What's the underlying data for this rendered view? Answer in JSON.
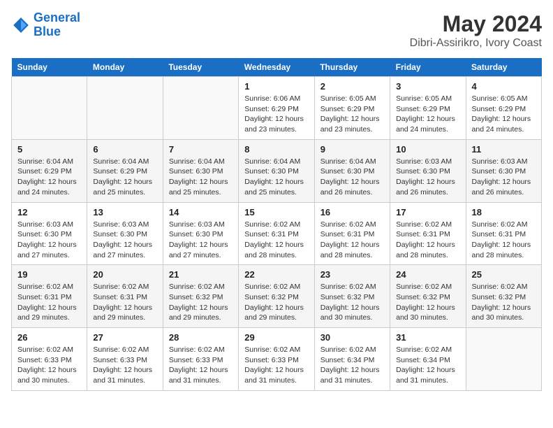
{
  "header": {
    "logo_line1": "General",
    "logo_line2": "Blue",
    "title": "May 2024",
    "subtitle": "Dibri-Assirikro, Ivory Coast"
  },
  "weekdays": [
    "Sunday",
    "Monday",
    "Tuesday",
    "Wednesday",
    "Thursday",
    "Friday",
    "Saturday"
  ],
  "weeks": [
    [
      {
        "day": "",
        "sunrise": "",
        "sunset": "",
        "daylight": ""
      },
      {
        "day": "",
        "sunrise": "",
        "sunset": "",
        "daylight": ""
      },
      {
        "day": "",
        "sunrise": "",
        "sunset": "",
        "daylight": ""
      },
      {
        "day": "1",
        "sunrise": "Sunrise: 6:06 AM",
        "sunset": "Sunset: 6:29 PM",
        "daylight": "Daylight: 12 hours and 23 minutes."
      },
      {
        "day": "2",
        "sunrise": "Sunrise: 6:05 AM",
        "sunset": "Sunset: 6:29 PM",
        "daylight": "Daylight: 12 hours and 23 minutes."
      },
      {
        "day": "3",
        "sunrise": "Sunrise: 6:05 AM",
        "sunset": "Sunset: 6:29 PM",
        "daylight": "Daylight: 12 hours and 24 minutes."
      },
      {
        "day": "4",
        "sunrise": "Sunrise: 6:05 AM",
        "sunset": "Sunset: 6:29 PM",
        "daylight": "Daylight: 12 hours and 24 minutes."
      }
    ],
    [
      {
        "day": "5",
        "sunrise": "Sunrise: 6:04 AM",
        "sunset": "Sunset: 6:29 PM",
        "daylight": "Daylight: 12 hours and 24 minutes."
      },
      {
        "day": "6",
        "sunrise": "Sunrise: 6:04 AM",
        "sunset": "Sunset: 6:29 PM",
        "daylight": "Daylight: 12 hours and 25 minutes."
      },
      {
        "day": "7",
        "sunrise": "Sunrise: 6:04 AM",
        "sunset": "Sunset: 6:30 PM",
        "daylight": "Daylight: 12 hours and 25 minutes."
      },
      {
        "day": "8",
        "sunrise": "Sunrise: 6:04 AM",
        "sunset": "Sunset: 6:30 PM",
        "daylight": "Daylight: 12 hours and 25 minutes."
      },
      {
        "day": "9",
        "sunrise": "Sunrise: 6:04 AM",
        "sunset": "Sunset: 6:30 PM",
        "daylight": "Daylight: 12 hours and 26 minutes."
      },
      {
        "day": "10",
        "sunrise": "Sunrise: 6:03 AM",
        "sunset": "Sunset: 6:30 PM",
        "daylight": "Daylight: 12 hours and 26 minutes."
      },
      {
        "day": "11",
        "sunrise": "Sunrise: 6:03 AM",
        "sunset": "Sunset: 6:30 PM",
        "daylight": "Daylight: 12 hours and 26 minutes."
      }
    ],
    [
      {
        "day": "12",
        "sunrise": "Sunrise: 6:03 AM",
        "sunset": "Sunset: 6:30 PM",
        "daylight": "Daylight: 12 hours and 27 minutes."
      },
      {
        "day": "13",
        "sunrise": "Sunrise: 6:03 AM",
        "sunset": "Sunset: 6:30 PM",
        "daylight": "Daylight: 12 hours and 27 minutes."
      },
      {
        "day": "14",
        "sunrise": "Sunrise: 6:03 AM",
        "sunset": "Sunset: 6:30 PM",
        "daylight": "Daylight: 12 hours and 27 minutes."
      },
      {
        "day": "15",
        "sunrise": "Sunrise: 6:02 AM",
        "sunset": "Sunset: 6:31 PM",
        "daylight": "Daylight: 12 hours and 28 minutes."
      },
      {
        "day": "16",
        "sunrise": "Sunrise: 6:02 AM",
        "sunset": "Sunset: 6:31 PM",
        "daylight": "Daylight: 12 hours and 28 minutes."
      },
      {
        "day": "17",
        "sunrise": "Sunrise: 6:02 AM",
        "sunset": "Sunset: 6:31 PM",
        "daylight": "Daylight: 12 hours and 28 minutes."
      },
      {
        "day": "18",
        "sunrise": "Sunrise: 6:02 AM",
        "sunset": "Sunset: 6:31 PM",
        "daylight": "Daylight: 12 hours and 28 minutes."
      }
    ],
    [
      {
        "day": "19",
        "sunrise": "Sunrise: 6:02 AM",
        "sunset": "Sunset: 6:31 PM",
        "daylight": "Daylight: 12 hours and 29 minutes."
      },
      {
        "day": "20",
        "sunrise": "Sunrise: 6:02 AM",
        "sunset": "Sunset: 6:31 PM",
        "daylight": "Daylight: 12 hours and 29 minutes."
      },
      {
        "day": "21",
        "sunrise": "Sunrise: 6:02 AM",
        "sunset": "Sunset: 6:32 PM",
        "daylight": "Daylight: 12 hours and 29 minutes."
      },
      {
        "day": "22",
        "sunrise": "Sunrise: 6:02 AM",
        "sunset": "Sunset: 6:32 PM",
        "daylight": "Daylight: 12 hours and 29 minutes."
      },
      {
        "day": "23",
        "sunrise": "Sunrise: 6:02 AM",
        "sunset": "Sunset: 6:32 PM",
        "daylight": "Daylight: 12 hours and 30 minutes."
      },
      {
        "day": "24",
        "sunrise": "Sunrise: 6:02 AM",
        "sunset": "Sunset: 6:32 PM",
        "daylight": "Daylight: 12 hours and 30 minutes."
      },
      {
        "day": "25",
        "sunrise": "Sunrise: 6:02 AM",
        "sunset": "Sunset: 6:32 PM",
        "daylight": "Daylight: 12 hours and 30 minutes."
      }
    ],
    [
      {
        "day": "26",
        "sunrise": "Sunrise: 6:02 AM",
        "sunset": "Sunset: 6:33 PM",
        "daylight": "Daylight: 12 hours and 30 minutes."
      },
      {
        "day": "27",
        "sunrise": "Sunrise: 6:02 AM",
        "sunset": "Sunset: 6:33 PM",
        "daylight": "Daylight: 12 hours and 31 minutes."
      },
      {
        "day": "28",
        "sunrise": "Sunrise: 6:02 AM",
        "sunset": "Sunset: 6:33 PM",
        "daylight": "Daylight: 12 hours and 31 minutes."
      },
      {
        "day": "29",
        "sunrise": "Sunrise: 6:02 AM",
        "sunset": "Sunset: 6:33 PM",
        "daylight": "Daylight: 12 hours and 31 minutes."
      },
      {
        "day": "30",
        "sunrise": "Sunrise: 6:02 AM",
        "sunset": "Sunset: 6:34 PM",
        "daylight": "Daylight: 12 hours and 31 minutes."
      },
      {
        "day": "31",
        "sunrise": "Sunrise: 6:02 AM",
        "sunset": "Sunset: 6:34 PM",
        "daylight": "Daylight: 12 hours and 31 minutes."
      },
      {
        "day": "",
        "sunrise": "",
        "sunset": "",
        "daylight": ""
      }
    ]
  ]
}
